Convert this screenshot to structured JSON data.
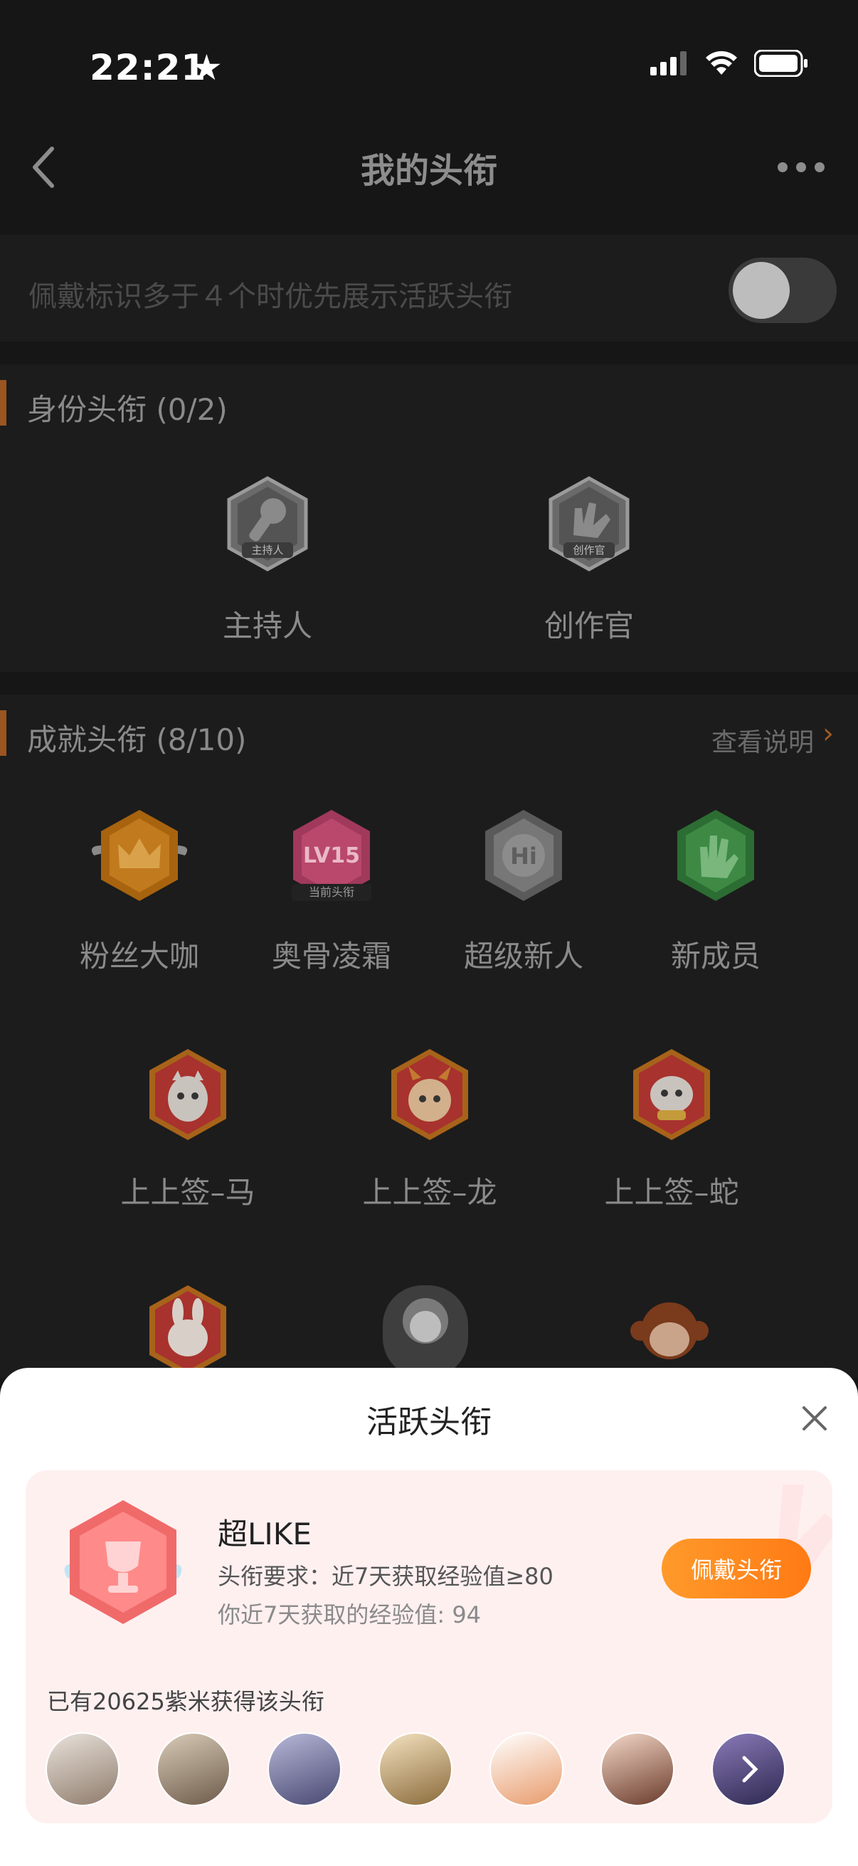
{
  "status_bar": {
    "time": "22:21"
  },
  "header": {
    "title": "我的头衔"
  },
  "setting": {
    "text": "佩戴标识多于４个时优先展示活跃头衔",
    "toggle_on": false
  },
  "identity": {
    "title": "身份头衔 (0/2)",
    "badges": [
      {
        "label": "主持人",
        "emblem": "主持人",
        "icon": "microphone-icon"
      },
      {
        "label": "创作官",
        "emblem": "创作官",
        "icon": "hand-icon"
      }
    ]
  },
  "achievement": {
    "title": "成就头衔 (8/10)",
    "link": "查看说明",
    "row1": [
      {
        "label": "粉丝大咖",
        "icon": "crown-icon",
        "color": "#b86a12"
      },
      {
        "label": "奥骨凌霜",
        "icon": "lv15-icon",
        "color": "#b93d6a",
        "emblem": "LV15",
        "tag": "当前头衔"
      },
      {
        "label": "超级新人",
        "icon": "hi-icon",
        "color": "#6a6a6a",
        "emblem": "Hi"
      },
      {
        "label": "新成员",
        "icon": "hand-icon",
        "color": "#2f7a3a"
      }
    ],
    "row2": [
      {
        "label": "上上签–马",
        "icon": "horse-icon"
      },
      {
        "label": "上上签–龙",
        "icon": "dragon-icon"
      },
      {
        "label": "上上签–蛇",
        "icon": "snake-icon"
      }
    ]
  },
  "sheet": {
    "title": "活跃头衔",
    "name": "超LIKE",
    "requirement": "头衔要求：近7天获取经验值≥80",
    "experience": "你近7天获取的经验值: 94",
    "wear_button": "佩戴头衔",
    "owners": "已有20625紫米获得该头衔"
  }
}
